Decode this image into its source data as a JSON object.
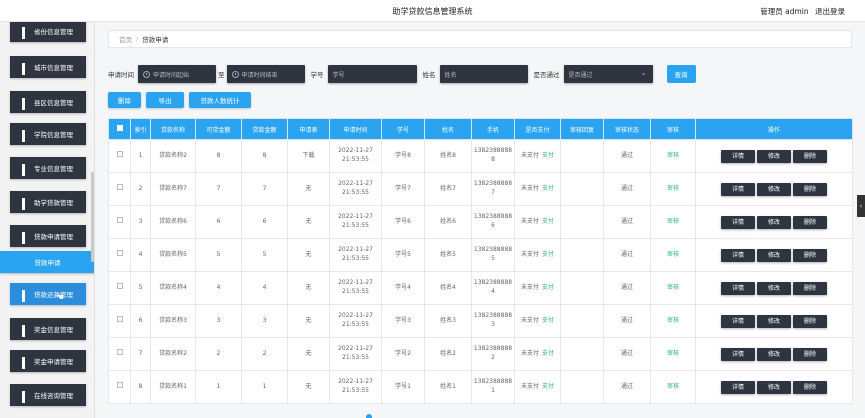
{
  "header": {
    "title": "助学贷款信息管理系统",
    "role": "管理员 admin",
    "logout": "退出登录"
  },
  "sidebar": {
    "items": [
      {
        "label": "省份信息管理"
      },
      {
        "label": "城市信息管理"
      },
      {
        "label": "县区信息管理"
      },
      {
        "label": "学院信息管理"
      },
      {
        "label": "专业信息管理"
      },
      {
        "label": "助学贷款管理"
      },
      {
        "label": "贷款申请管理"
      },
      {
        "label": "贷款申请"
      },
      {
        "label": "贷款还款管理"
      },
      {
        "label": "奖金信息管理"
      },
      {
        "label": "奖金申请管理"
      },
      {
        "label": "在线咨询管理"
      }
    ]
  },
  "breadcrumb": {
    "home": "首页",
    "separator": "/",
    "current": "贷款申请"
  },
  "search": {
    "time_label": "申请时间",
    "start_placeholder": "申请时间起始",
    "to_label": "至",
    "end_placeholder": "申请时间结束",
    "student_label": "学号",
    "student_placeholder": "学号",
    "name_label": "姓名",
    "name_placeholder": "姓名",
    "pass_label": "是否通过",
    "pass_placeholder": "是否通过",
    "search_button": "查询"
  },
  "actions": {
    "delete": "删除",
    "export": "导出",
    "stats": "贷款人数统计"
  },
  "table": {
    "headers": [
      "索引",
      "贷款名称",
      "可贷金额",
      "贷款金额",
      "申请表",
      "申请时间",
      "学号",
      "姓名",
      "手机",
      "是否支付",
      "审核回复",
      "审核状态",
      "审核",
      "操作"
    ],
    "rows": [
      {
        "index": "1",
        "name": "贷款名称2",
        "avail": "8",
        "amount": "8",
        "form": "下载",
        "date": "2022-11-27",
        "time": "21:53:55",
        "sno": "学号8",
        "sname": "姓名8",
        "phone1": "1382388888",
        "phone2": "8",
        "paid": "未支付",
        "pay": "支付",
        "reply": "",
        "status": "通过",
        "audit": "审核"
      },
      {
        "index": "2",
        "name": "贷款名称7",
        "avail": "7",
        "amount": "7",
        "form": "无",
        "date": "2022-11-27",
        "time": "21:53:55",
        "sno": "学号7",
        "sname": "姓名7",
        "phone1": "1382388888",
        "phone2": "7",
        "paid": "未支付",
        "pay": "支付",
        "reply": "",
        "status": "通过",
        "audit": "审核"
      },
      {
        "index": "3",
        "name": "贷款名称6",
        "avail": "6",
        "amount": "6",
        "form": "无",
        "date": "2022-11-27",
        "time": "21:53:55",
        "sno": "学号6",
        "sname": "姓名6",
        "phone1": "1382388888",
        "phone2": "6",
        "paid": "未支付",
        "pay": "支付",
        "reply": "",
        "status": "通过",
        "audit": "审核"
      },
      {
        "index": "4",
        "name": "贷款名称5",
        "avail": "5",
        "amount": "5",
        "form": "无",
        "date": "2022-11-27",
        "time": "21:53:55",
        "sno": "学号5",
        "sname": "姓名5",
        "phone1": "1382388888",
        "phone2": "5",
        "paid": "未支付",
        "pay": "支付",
        "reply": "",
        "status": "通过",
        "audit": "审核"
      },
      {
        "index": "5",
        "name": "贷款名称4",
        "avail": "4",
        "amount": "4",
        "form": "无",
        "date": "2022-11-27",
        "time": "21:53:55",
        "sno": "学号4",
        "sname": "姓名4",
        "phone1": "1382388888",
        "phone2": "4",
        "paid": "未支付",
        "pay": "支付",
        "reply": "",
        "status": "通过",
        "audit": "审核"
      },
      {
        "index": "6",
        "name": "贷款名称3",
        "avail": "3",
        "amount": "3",
        "form": "无",
        "date": "2022-11-27",
        "time": "21:53:55",
        "sno": "学号3",
        "sname": "姓名3",
        "phone1": "1382388888",
        "phone2": "3",
        "paid": "未支付",
        "pay": "支付",
        "reply": "",
        "status": "通过",
        "audit": "审核"
      },
      {
        "index": "7",
        "name": "贷款名称2",
        "avail": "2",
        "amount": "2",
        "form": "无",
        "date": "2022-11-27",
        "time": "21:53:55",
        "sno": "学号2",
        "sname": "姓名2",
        "phone1": "1382388888",
        "phone2": "2",
        "paid": "未支付",
        "pay": "支付",
        "reply": "",
        "status": "通过",
        "audit": "审核"
      },
      {
        "index": "8",
        "name": "贷款名称1",
        "avail": "1",
        "amount": "1",
        "form": "无",
        "date": "2022-11-27",
        "time": "21:53:55",
        "sno": "学号1",
        "sname": "姓名1",
        "phone1": "1382388888",
        "phone2": "1",
        "paid": "未支付",
        "pay": "支付",
        "reply": "",
        "status": "通过",
        "audit": "审核"
      }
    ],
    "row_actions": {
      "detail": "详情",
      "edit": "修改",
      "delete": "删除"
    }
  },
  "colors": {
    "accent": "#2aa3f0",
    "dark": "#2e3440",
    "success": "#2bb673"
  },
  "icons": {
    "menu": "grid-icon",
    "active": "pointer-cursor-icon",
    "collapse": "chevron-left-icon"
  }
}
